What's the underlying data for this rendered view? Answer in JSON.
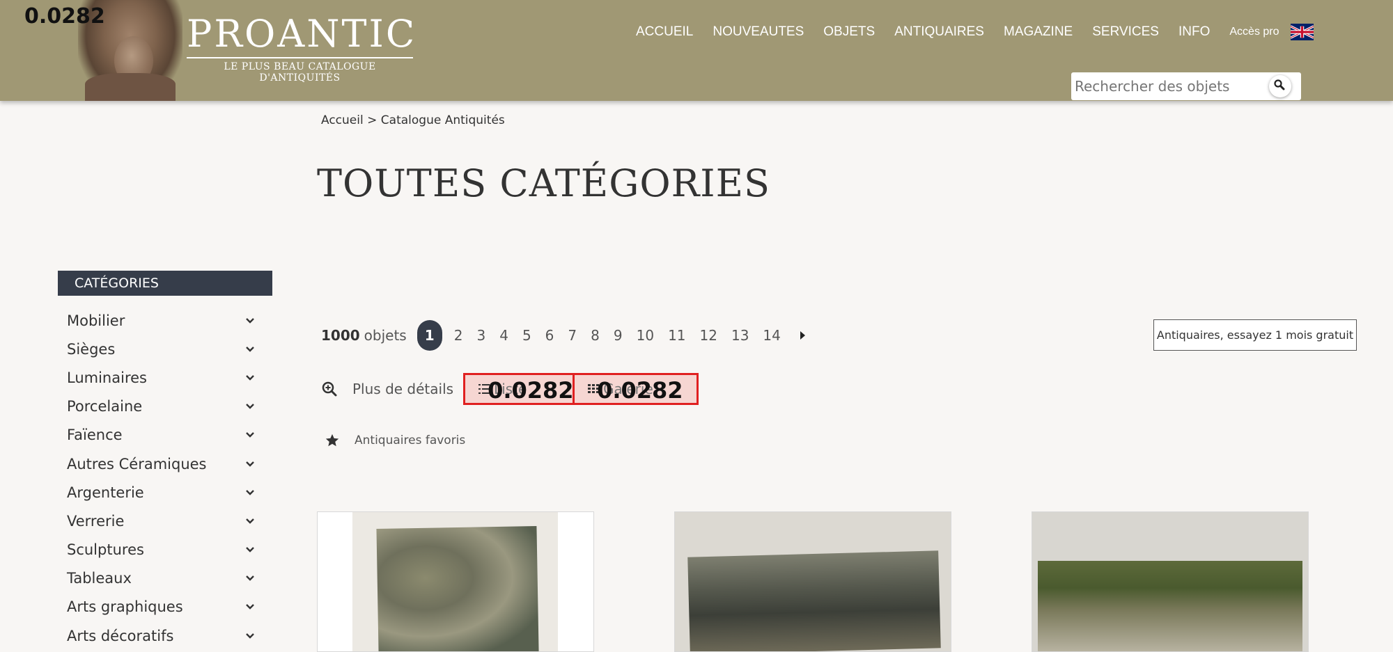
{
  "overlay": {
    "value": "0.0282"
  },
  "header": {
    "logo_title": "PROANTIC",
    "logo_subtitle": "LE PLUS BEAU CATALOGUE D'ANTIQUITÉS",
    "nav": [
      "ACCUEIL",
      "NOUVEAUTES",
      "OBJETS",
      "ANTIQUAIRES",
      "MAGAZINE",
      "SERVICES",
      "INFO"
    ],
    "pro_link": "Accès pro",
    "language_icon": "uk-flag-icon",
    "search_placeholder": "Rechercher des objets",
    "brand_color": "#a09874"
  },
  "breadcrumb": {
    "home": "Accueil",
    "separator": ">",
    "current": "Catalogue Antiquités"
  },
  "page_title": "TOUTES CATÉGORIES",
  "sidebar": {
    "header": "CATÉGORIES",
    "items": [
      "Mobilier",
      "Sièges",
      "Luminaires",
      "Porcelaine",
      "Faïence",
      "Autres Céramiques",
      "Argenterie",
      "Verrerie",
      "Sculptures",
      "Tableaux",
      "Arts graphiques",
      "Arts décoratifs"
    ]
  },
  "pagination": {
    "count": "1000",
    "count_label": "objets",
    "current_page": "1",
    "pages": [
      "2",
      "3",
      "4",
      "5",
      "6",
      "7",
      "8",
      "9",
      "10",
      "11",
      "12",
      "13",
      "14"
    ]
  },
  "trial_button": "Antiquaires, essayez 1 mois gratuit",
  "view_options": {
    "details_label": "Plus de détails",
    "list_label": "Liste",
    "gallery_label": "Galerie",
    "overlay_value": "0.0282",
    "highlight_color": "#e02020"
  },
  "favorites_label": "Antiquaires favoris"
}
